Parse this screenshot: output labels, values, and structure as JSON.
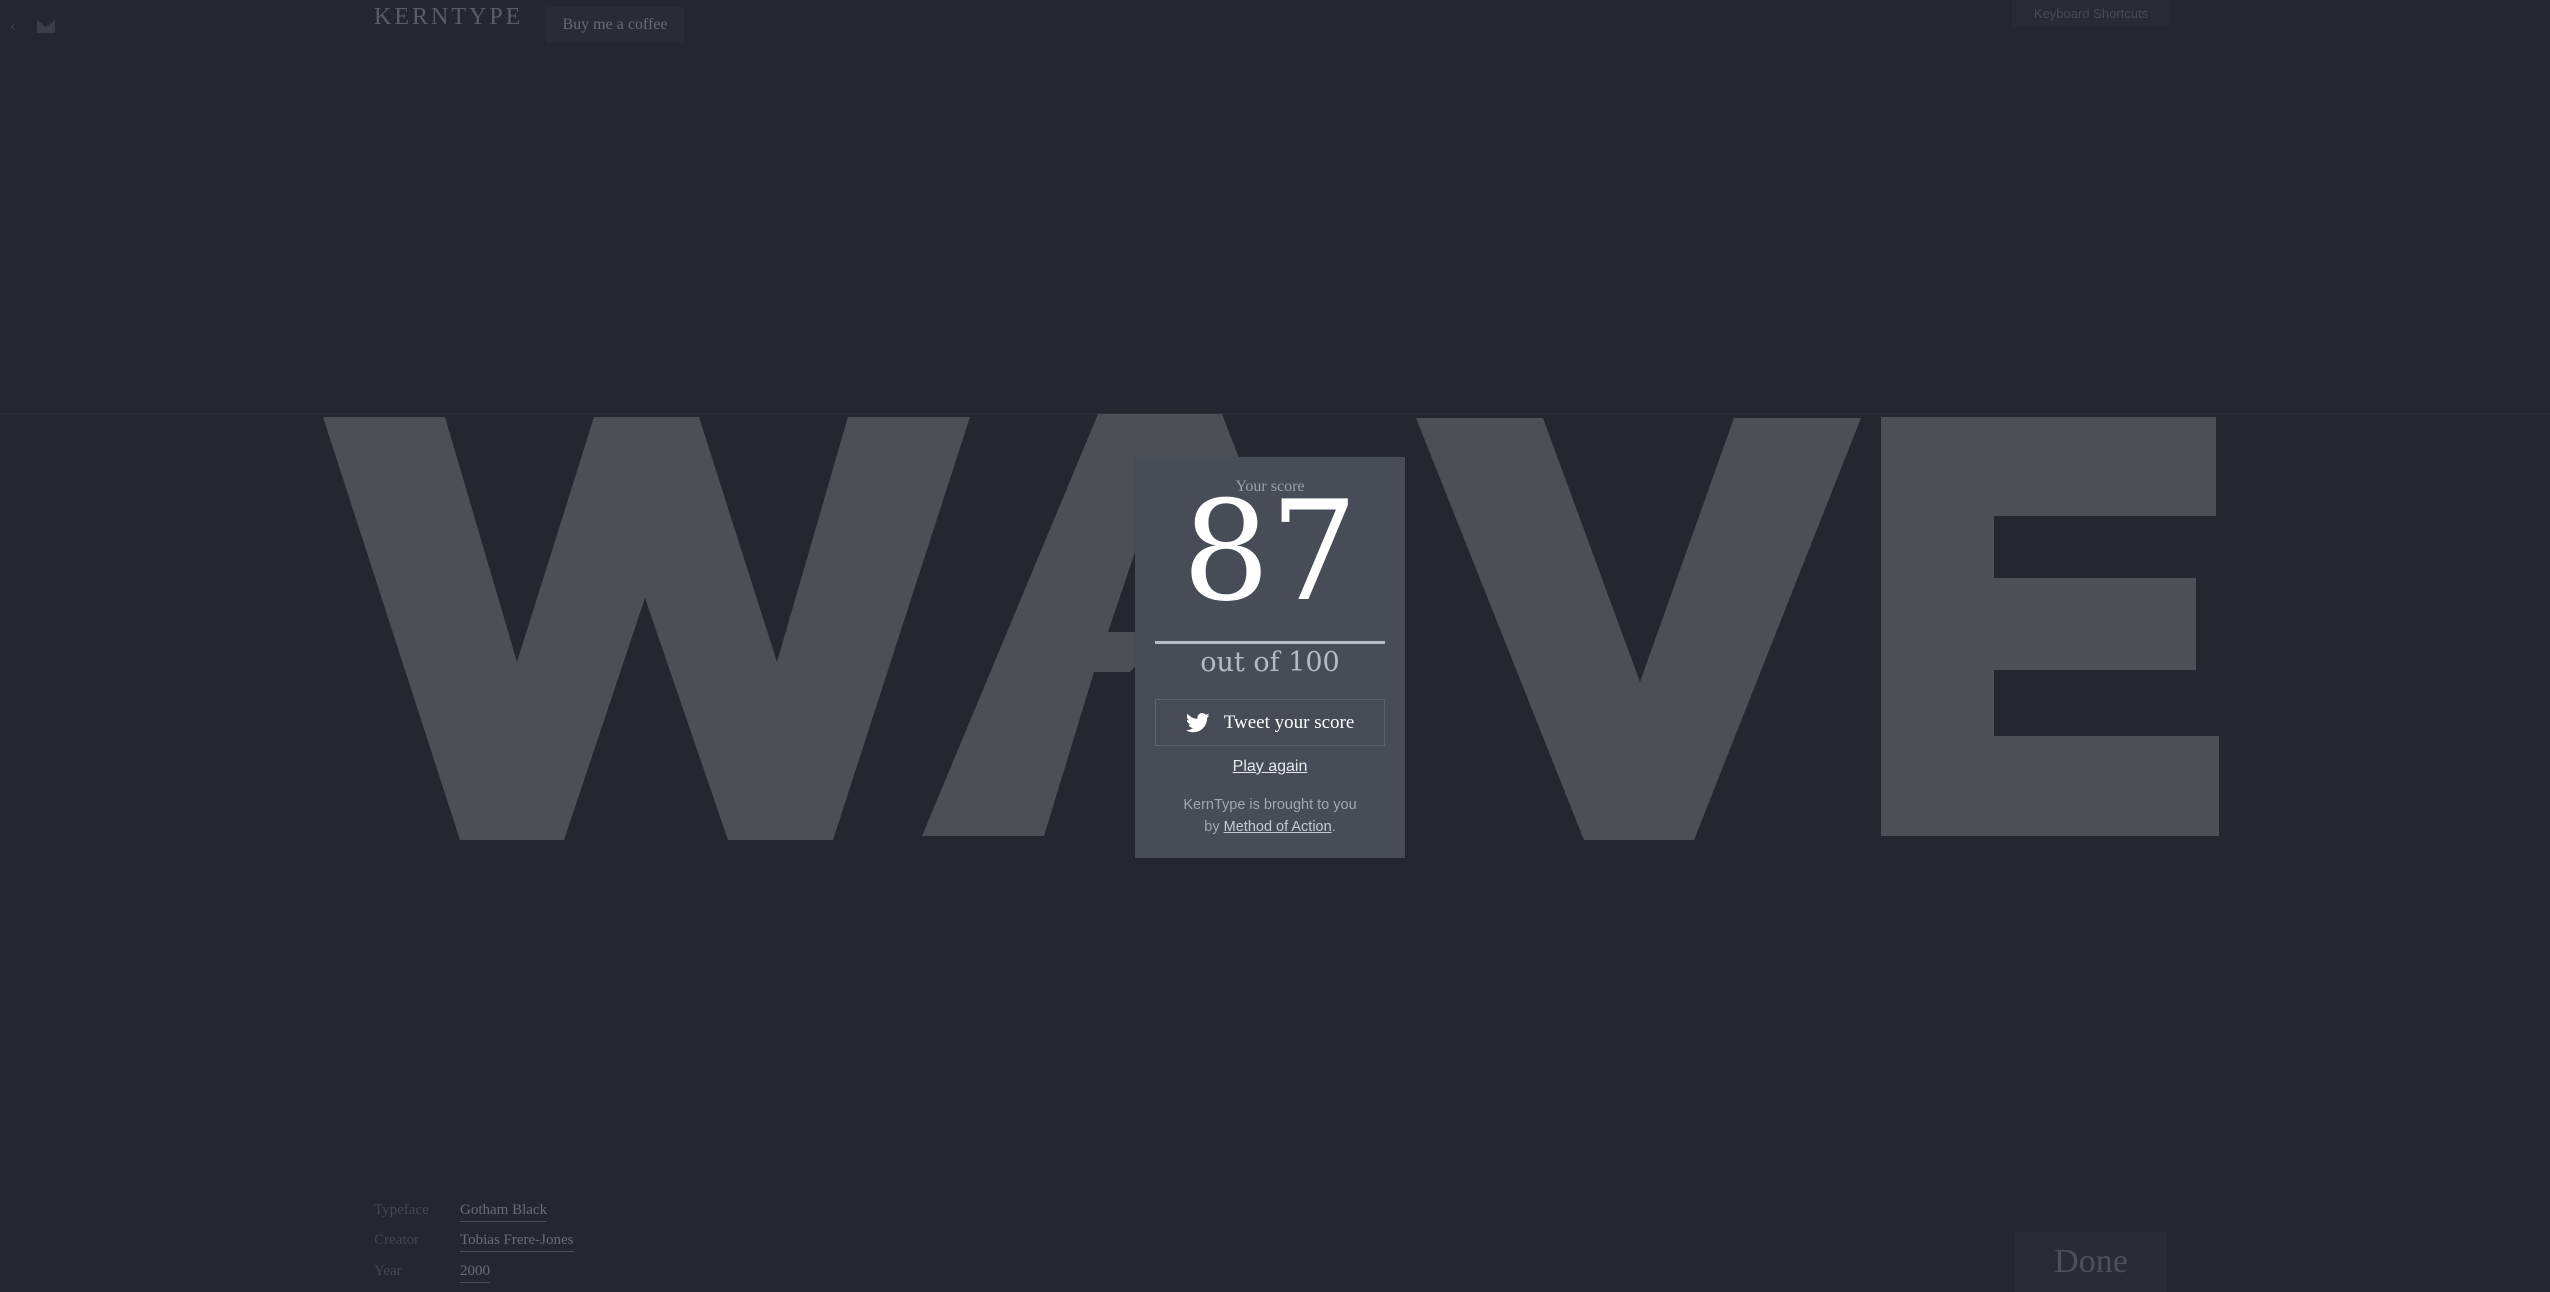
{
  "header": {
    "back_glyph": "‹",
    "logo_icon": "moa-logo-icon",
    "brand": "KERNTYPE",
    "coffee_label": "Buy me a coffee",
    "shortcuts_label": "Keyboard Shortcuts"
  },
  "game": {
    "word": "WAVE",
    "letters": [
      "W",
      "A",
      "V",
      "E"
    ]
  },
  "score_modal": {
    "label": "Your score",
    "score": "87",
    "out_of": "out of 100",
    "tweet_label": "Tweet your score",
    "tweet_icon": "twitter-bird-icon",
    "play_again": "Play again",
    "credit_prefix": "KernType is brought to you by",
    "credit_link": "Method of Action",
    "credit_suffix": "."
  },
  "font_info": {
    "rows": [
      {
        "key": "Typeface",
        "value": "Gotham Black"
      },
      {
        "key": "Creator",
        "value": "Tobias Frere-Jones"
      },
      {
        "key": "Year",
        "value": "2000"
      }
    ]
  },
  "footer": {
    "done_label": "Done"
  },
  "colors": {
    "background": "#262630",
    "letters": "#4e4e56",
    "modal": "#474c57"
  }
}
